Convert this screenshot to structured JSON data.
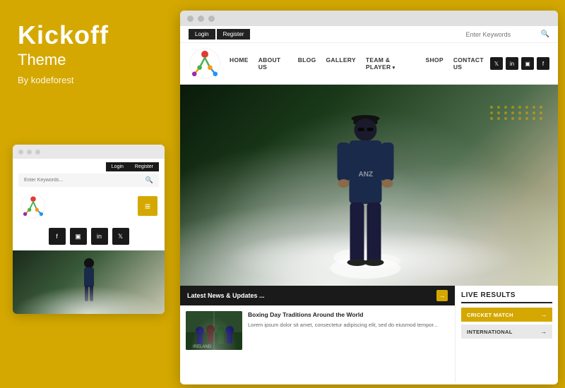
{
  "brand": {
    "title": "Kickoff",
    "subtitle": "Theme",
    "by": "By kodeforest"
  },
  "mini_browser": {
    "dots": [
      "dot1",
      "dot2",
      "dot3"
    ],
    "login_label": "Login",
    "register_label": "Register",
    "search_placeholder": "Enter Keywords...",
    "hamburger_icon": "≡",
    "social": [
      {
        "icon": "f",
        "name": "facebook"
      },
      {
        "icon": "▣",
        "name": "youtube"
      },
      {
        "icon": "in",
        "name": "linkedin"
      },
      {
        "icon": "𝕏",
        "name": "twitter"
      }
    ]
  },
  "main_browser": {
    "dots": [
      "dot1",
      "dot2",
      "dot3"
    ],
    "topbar": {
      "login_label": "Login",
      "register_label": "Register",
      "search_placeholder": "Enter Keywords",
      "search_icon": "🔍"
    },
    "navbar": {
      "links": [
        {
          "label": "HOME",
          "dropdown": false
        },
        {
          "label": "ABOUT US",
          "dropdown": false
        },
        {
          "label": "BLOG",
          "dropdown": false
        },
        {
          "label": "GALLERY",
          "dropdown": false
        },
        {
          "label": "TEAM & PLAYER",
          "dropdown": true
        },
        {
          "label": "SHOP",
          "dropdown": false
        },
        {
          "label": "CONTACT US",
          "dropdown": false
        }
      ],
      "social": [
        {
          "icon": "t",
          "name": "twitter"
        },
        {
          "icon": "in",
          "name": "linkedin"
        },
        {
          "icon": "▣",
          "name": "youtube"
        },
        {
          "icon": "f",
          "name": "facebook"
        }
      ]
    },
    "news": {
      "header": "Latest News & Updates ...",
      "article_title": "Boxing Day Traditions Around the World",
      "article_excerpt": "Lorem ipsum dolor sit amet, consectetur adipiscing elit, sed do eiusmod tempor..."
    },
    "live_results": {
      "header": "LIVE RESULTS",
      "items": [
        {
          "label": "CRICKET MATCH",
          "arrow": "→",
          "style": "yellow"
        },
        {
          "label": "INTERNATIONAL",
          "arrow": "→",
          "style": "gray"
        }
      ]
    }
  }
}
